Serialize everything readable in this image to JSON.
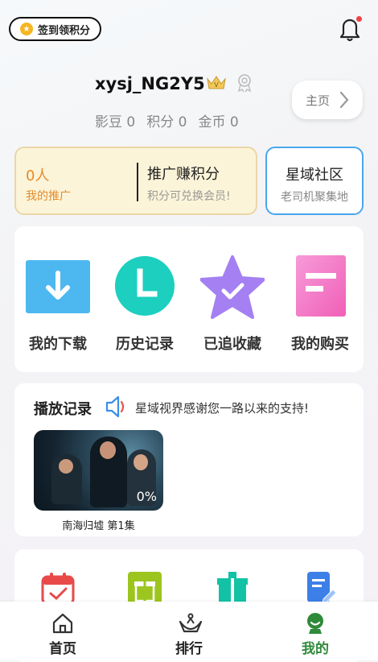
{
  "header": {
    "checkin_label": "签到领积分"
  },
  "profile": {
    "username": "xysj_NG2Y5",
    "stats": [
      {
        "label": "影豆",
        "value": "0"
      },
      {
        "label": "积分",
        "value": "0"
      },
      {
        "label": "金币",
        "value": "0"
      }
    ],
    "home_label": "主页"
  },
  "promo": {
    "count": "0人",
    "my_promotion": "我的推广",
    "title": "推广赚积分",
    "desc": "积分可兑换会员!"
  },
  "community": {
    "title": "星域社区",
    "subtitle": "老司机聚集地"
  },
  "features": [
    {
      "label": "我的下载",
      "icon": "download-icon"
    },
    {
      "label": "历史记录",
      "icon": "history-icon"
    },
    {
      "label": "已追收藏",
      "icon": "star-favorite-icon"
    },
    {
      "label": "我的购买",
      "icon": "purchase-icon"
    }
  ],
  "history": {
    "title": "播放记录",
    "notice": "星域视界感谢您一路以来的支持!",
    "items": [
      {
        "title": "南海归墟 第1集",
        "progress": "0%"
      }
    ]
  },
  "tabs": [
    {
      "label": "首页",
      "icon": "home-icon",
      "active": false
    },
    {
      "label": "排行",
      "icon": "ranking-icon",
      "active": false
    },
    {
      "label": "我的",
      "icon": "profile-icon",
      "active": true
    }
  ],
  "colors": {
    "accent_green": "#2f8a3a",
    "promo_orange": "#e58a2a",
    "community_border": "#49a7ee"
  }
}
